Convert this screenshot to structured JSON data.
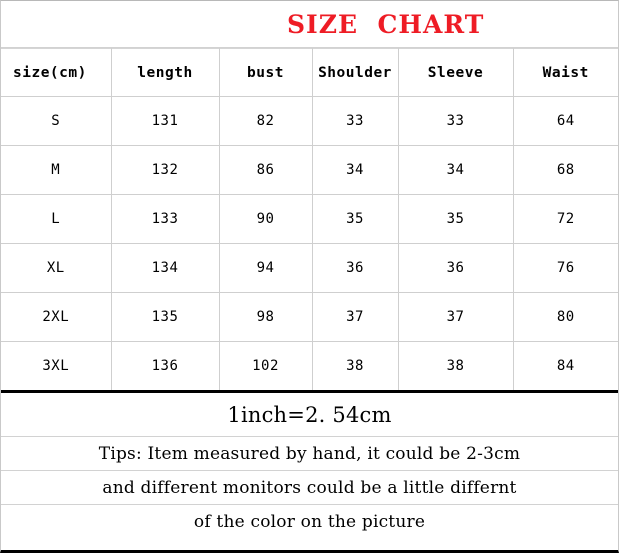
{
  "title": {
    "text": "SIZE  CHART",
    "color": "#ee1c25"
  },
  "table": {
    "headers": [
      "size(cm)",
      "length",
      "bust",
      "Shoulder",
      "Sleeve",
      "Waist"
    ],
    "rows": [
      {
        "size": "S",
        "length": "131",
        "bust": "82",
        "shoulder": "33",
        "sleeve": "33",
        "waist": "64"
      },
      {
        "size": "M",
        "length": "132",
        "bust": "86",
        "shoulder": "34",
        "sleeve": "34",
        "waist": "68"
      },
      {
        "size": "L",
        "length": "133",
        "bust": "90",
        "shoulder": "35",
        "sleeve": "35",
        "waist": "72"
      },
      {
        "size": "XL",
        "length": "134",
        "bust": "94",
        "shoulder": "36",
        "sleeve": "36",
        "waist": "76"
      },
      {
        "size": "2XL",
        "length": "135",
        "bust": "98",
        "shoulder": "37",
        "sleeve": "37",
        "waist": "80"
      },
      {
        "size": "3XL",
        "length": "136",
        "bust": "102",
        "shoulder": "38",
        "sleeve": "38",
        "waist": "84"
      }
    ]
  },
  "notes": {
    "conversion": "1inch=2. 54cm",
    "tips": [
      "Tips: Item measured by hand, it could be 2-3cm",
      "and different monitors could be a little differnt",
      "of the color on the picture"
    ]
  },
  "chart_data": {
    "type": "table",
    "title": "SIZE  CHART",
    "columns": [
      "size(cm)",
      "length",
      "bust",
      "Shoulder",
      "Sleeve",
      "Waist"
    ],
    "rows": [
      [
        "S",
        131,
        82,
        33,
        33,
        64
      ],
      [
        "M",
        132,
        86,
        34,
        34,
        68
      ],
      [
        "L",
        133,
        90,
        35,
        35,
        72
      ],
      [
        "XL",
        134,
        94,
        36,
        36,
        76
      ],
      [
        "2XL",
        135,
        98,
        37,
        37,
        80
      ],
      [
        "3XL",
        136,
        102,
        38,
        38,
        84
      ]
    ],
    "units": "cm",
    "notes": [
      "1inch=2.54cm",
      "Tips: Item measured by hand, it could be 2-3cm",
      "and different monitors could be a little differnt",
      "of the color on the picture"
    ]
  }
}
